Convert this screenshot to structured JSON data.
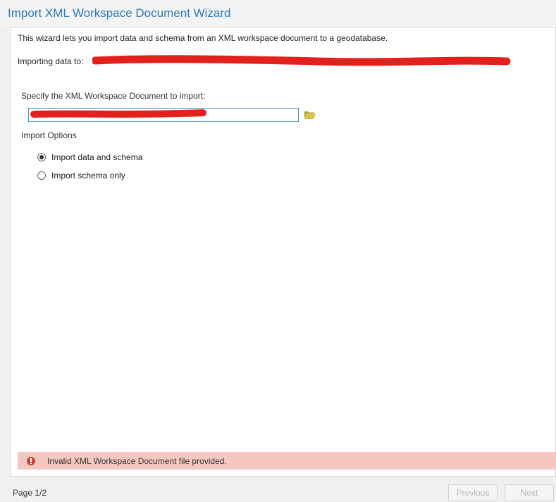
{
  "window": {
    "title": "Import XML Workspace Document Wizard"
  },
  "wizard": {
    "intro_text": "This wizard lets you import data and schema from an XML workspace document to a geodatabase.",
    "importing_label": "Importing data to:",
    "importing_value_redacted": true,
    "specify_label": "Specify the XML Workspace Document to import:",
    "document_path_value": "",
    "browse_icon": "folder-open-icon",
    "import_options_label": "Import Options",
    "options": [
      {
        "label": "Import data and schema",
        "selected": true
      },
      {
        "label": "Import schema only",
        "selected": false
      }
    ]
  },
  "error": {
    "icon": "error-exclamation-icon",
    "message": "Invalid XML Workspace Document file provided."
  },
  "footer": {
    "page_indicator": "Page 1/2",
    "previous_label": "Previous",
    "next_label": "Next",
    "previous_enabled": false,
    "next_enabled": false
  },
  "colors": {
    "title": "#2b7bbf",
    "error_bg": "#f4c7c1",
    "error_icon": "#c9463a",
    "redaction": "#e3211c",
    "folder_icon": "#c9b43c",
    "input_border": "#4a90c9"
  }
}
